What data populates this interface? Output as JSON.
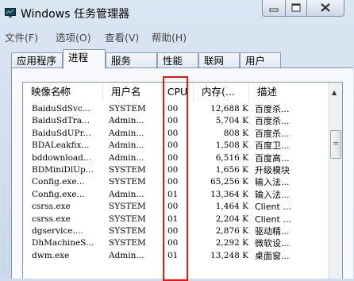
{
  "window": {
    "title": "Windows 任务管理器",
    "controls": [
      "minimize",
      "maximize",
      "close"
    ]
  },
  "menu": [
    {
      "label": "文件(F)"
    },
    {
      "label": "选项(O)"
    },
    {
      "label": "查看(V)"
    },
    {
      "label": "帮助(H)"
    }
  ],
  "tabs": [
    {
      "label": "应用程序",
      "active": false
    },
    {
      "label": "进程",
      "active": true
    },
    {
      "label": "服务",
      "active": false
    },
    {
      "label": "性能",
      "active": false
    },
    {
      "label": "联网",
      "active": false
    },
    {
      "label": "用户",
      "active": false
    }
  ],
  "columns": {
    "name": "映像名称",
    "user": "用户名",
    "cpu": "CPU",
    "memory": "内存(...",
    "description": "描述"
  },
  "processes": [
    {
      "name": "BaiduSdSvc...",
      "user": "SYSTEM",
      "cpu": "00",
      "memory": "12,688 K",
      "description": "百度杀..."
    },
    {
      "name": "BaiduSdTra...",
      "user": "Admin...",
      "cpu": "00",
      "memory": "5,704 K",
      "description": "百度杀..."
    },
    {
      "name": "BaiduSdUPr...",
      "user": "Admin...",
      "cpu": "00",
      "memory": "808 K",
      "description": "百度杀..."
    },
    {
      "name": "BDALeakfix...",
      "user": "Admin...",
      "cpu": "00",
      "memory": "1,508 K",
      "description": "百度卫..."
    },
    {
      "name": "bddownload...",
      "user": "Admin...",
      "cpu": "00",
      "memory": "6,516 K",
      "description": "百度高..."
    },
    {
      "name": "BDMiniDlUp...",
      "user": "SYSTEM",
      "cpu": "00",
      "memory": "1,656 K",
      "description": "升级模块"
    },
    {
      "name": "Config.exe...",
      "user": "SYSTEM",
      "cpu": "00",
      "memory": "65,256 K",
      "description": "输入法..."
    },
    {
      "name": "Config.exe...",
      "user": "Admin...",
      "cpu": "01",
      "memory": "13,364 K",
      "description": "输入法..."
    },
    {
      "name": "csrss.exe",
      "user": "SYSTEM",
      "cpu": "00",
      "memory": "1,464 K",
      "description": "Client ..."
    },
    {
      "name": "csrss.exe",
      "user": "SYSTEM",
      "cpu": "01",
      "memory": "2,204 K",
      "description": "Client ..."
    },
    {
      "name": "dgservice....",
      "user": "SYSTEM",
      "cpu": "00",
      "memory": "2,876 K",
      "description": "驱动精..."
    },
    {
      "name": "DhMachineS...",
      "user": "SYSTEM",
      "cpu": "00",
      "memory": "2,292 K",
      "description": "微软设..."
    },
    {
      "name": "dwm.exe",
      "user": "Admin...",
      "cpu": "01",
      "memory": "13,248 K",
      "description": "桌面窗..."
    }
  ],
  "colors": {
    "highlight_box": "#e01818",
    "window_frame": "#cfdbea"
  },
  "icons": {
    "app": "task-manager-icon",
    "scroll_up": "scroll-up-arrow-icon",
    "sort": "sort-ascending-icon"
  }
}
